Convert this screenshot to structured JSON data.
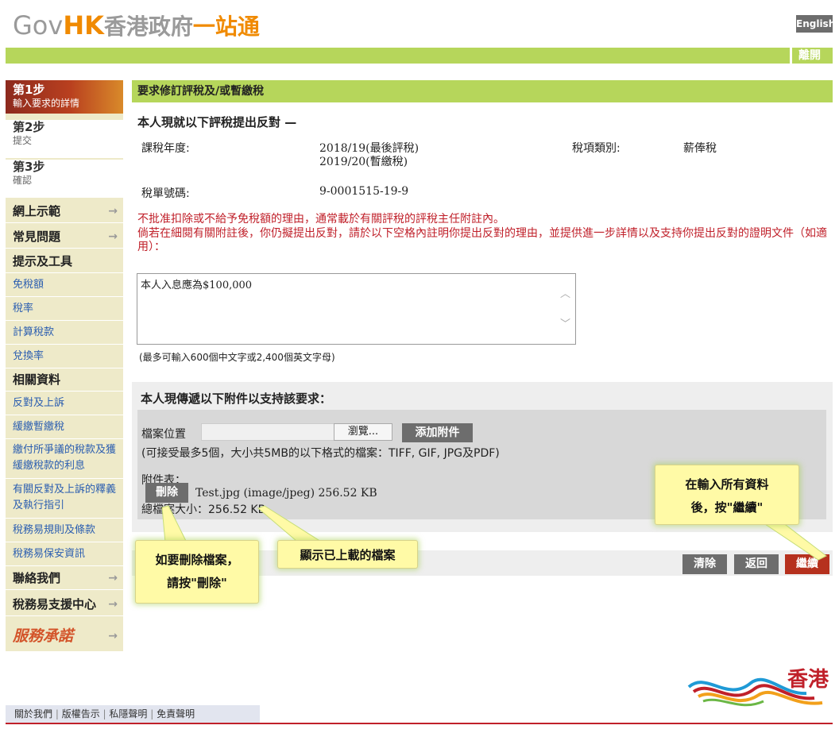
{
  "header": {
    "logo_gov": "Gov",
    "logo_hk": "HK",
    "logo_cn": "香港政府",
    "logo_stop": "一站通",
    "language_button": "English",
    "logout": "離開"
  },
  "sidebar": {
    "steps": [
      {
        "title": "第1步",
        "subtitle": "輸入要求的詳情"
      },
      {
        "title": "第2步",
        "subtitle": "提交"
      },
      {
        "title": "第3步",
        "subtitle": "確認"
      }
    ],
    "nav": [
      {
        "label": "網上示範",
        "arrow": "→"
      },
      {
        "label": "常見問題",
        "arrow": "→"
      },
      {
        "label": "提示及工具"
      },
      {
        "label": "免稅額"
      },
      {
        "label": "稅率"
      },
      {
        "label": "計算稅款"
      },
      {
        "label": "兌換率"
      },
      {
        "label": "相關資料"
      },
      {
        "label": "反對及上訴"
      },
      {
        "label": "緩繳暫繳稅"
      },
      {
        "label": "繳付所爭議的稅款及獲緩繳稅款的利息"
      },
      {
        "label": "有關反對及上訴的釋義及執行指引"
      },
      {
        "label": "稅務易規則及條款"
      },
      {
        "label": "稅務易保安資訊"
      },
      {
        "label": "聯絡我們",
        "arrow": "→"
      },
      {
        "label": "稅務易支援中心",
        "arrow": "→"
      },
      {
        "label": "服務承諾",
        "arrow": "→"
      }
    ]
  },
  "main": {
    "section_title": "要求修訂評稅及/或暫繳稅",
    "objection_heading": "本人現就以下評稅提出反對 —",
    "year_label": "課稅年度:",
    "year_value_1": "2018/19(最後評稅)",
    "year_value_2": "2019/20(暫繳稅)",
    "tax_type_label": "稅項類別:",
    "tax_type_value": "薪俸稅",
    "bill_no_label": "稅單號碼:",
    "bill_no_value": "9-0001515-19-9",
    "warning_1": "不批准扣除或不給予免稅額的理由，通常載於有關評稅的評稅主任附註內。",
    "warning_2": "倘若在細閱有關附註後，你仍擬提出反對，請於以下空格內註明你提出反對的理由，並提供進一步詳情以及支持你提出反對的證明文件（如適用）：",
    "reason_text": "本人入息應為$100,000",
    "char_limit_hint": "(最多可輸入600個中文字或2,400個英文字母)",
    "attach_heading": "本人現傳遞以下附件以支持該要求：",
    "file_location_label": "檔案位置",
    "browse_label": "瀏覽...",
    "add_attachment_label": "添加附件",
    "accepted_formats": "(可接受最多5個，大小共5MB的以下格式的檔案：TIFF, GIF, JPG及PDF)",
    "attachment_list_label": "附件表：",
    "delete_label": "刪除",
    "file_entry": "Test.jpg (image/jpeg) 256.52 KB",
    "total_size": "總檔案大小：256.52 KB",
    "clear_label": "清除",
    "back_label": "返回",
    "continue_label": "繼續"
  },
  "callouts": {
    "continue_tip_1": "在輸入所有資料",
    "continue_tip_2": "後，按\"繼續\"",
    "uploaded_tip": "顯示已上載的檔案",
    "delete_tip_1": "如要刪除檔案，",
    "delete_tip_2": "請按\"刪除\""
  },
  "footer": {
    "links": [
      "關於我們",
      "版權告示",
      "私隱聲明",
      "免責聲明"
    ],
    "brand": "香港"
  },
  "colors": {
    "green_bar": "#b6d65b",
    "step_active": "#b9401f",
    "warning_red": "#c0202a",
    "button_gray": "#6d6d6d",
    "continue_red": "#b6311e",
    "sidebar_bg": "#eeeac9",
    "callout_yellow": "#fffaa6"
  }
}
